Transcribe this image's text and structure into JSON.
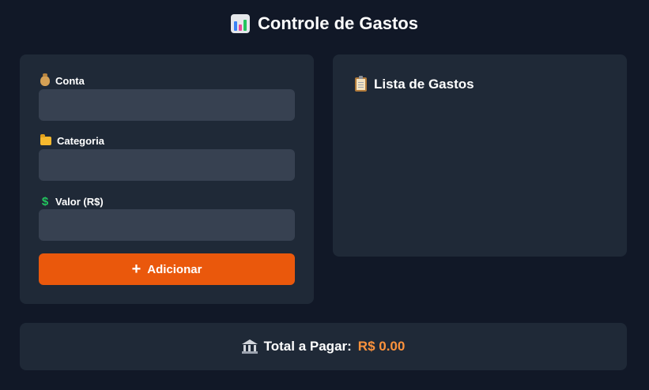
{
  "header": {
    "title": "Controle de Gastos",
    "icon": "bar-chart-icon"
  },
  "form": {
    "fields": [
      {
        "label": "Conta",
        "icon": "money-bag-icon",
        "value": "",
        "placeholder": ""
      },
      {
        "label": "Categoria",
        "icon": "folder-icon",
        "value": "",
        "placeholder": ""
      },
      {
        "label": "Valor (R$)",
        "icon": "dollar-icon",
        "value": "",
        "placeholder": ""
      }
    ],
    "add_button": {
      "label": "Adicionar",
      "icon": "plus-icon"
    },
    "dollar_glyph": "$"
  },
  "list": {
    "title": "Lista de Gastos",
    "icon": "clipboard-icon",
    "items": []
  },
  "total": {
    "label": "Total a Pagar:",
    "value": "R$ 0.00",
    "icon": "bank-icon"
  },
  "colors": {
    "background": "#111827",
    "panel": "#1f2937",
    "input": "#374151",
    "accent": "#ea580c",
    "total_value": "#fb923c"
  }
}
